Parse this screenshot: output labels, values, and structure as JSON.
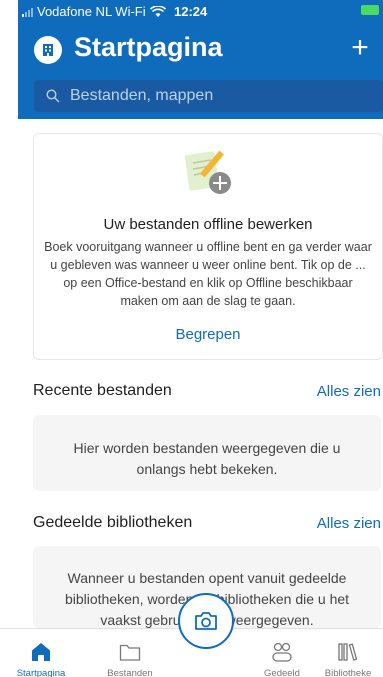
{
  "status_bar": {
    "carrier": "Vodafone NL Wi-Fi",
    "time": "12:24"
  },
  "header": {
    "title": "Startpagina",
    "add_label": "+",
    "search_placeholder": "Bestanden, mappen"
  },
  "tip_card": {
    "heading": "Uw bestanden offline bewerken",
    "body": "Boek vooruitgang wanneer u offline bent en ga verder waar u gebleven was wanneer u weer online bent. Tik op de ... op een Office-bestand en klik op Offline beschikbaar maken om aan de slag te gaan.",
    "action": "Begrepen"
  },
  "recent": {
    "title": "Recente bestanden",
    "link": "Alles zien",
    "empty_text": "Hier worden bestanden weergegeven die u onlangs hebt bekeken."
  },
  "shared_libraries": {
    "title": "Gedeelde bibliotheken",
    "link": "Alles zien",
    "empty_text": "Wanneer u bestanden opent vanuit gedeelde bibliotheken, worden de bibliotheken die u het vaakst gebruikt hier weergegeven."
  },
  "tabs": [
    {
      "label": "Startpagina",
      "icon": "home-icon",
      "active": true
    },
    {
      "label": "Bestanden",
      "icon": "folder-icon",
      "active": false
    },
    {
      "label": "",
      "icon": "camera-icon",
      "active": false
    },
    {
      "label": "Gedeeld",
      "icon": "people-icon",
      "active": false
    },
    {
      "label": "Bibliotheke",
      "icon": "library-icon",
      "active": false
    }
  ],
  "colors": {
    "brand": "#0f6cbd",
    "search_bg": "#1a5aa3"
  }
}
